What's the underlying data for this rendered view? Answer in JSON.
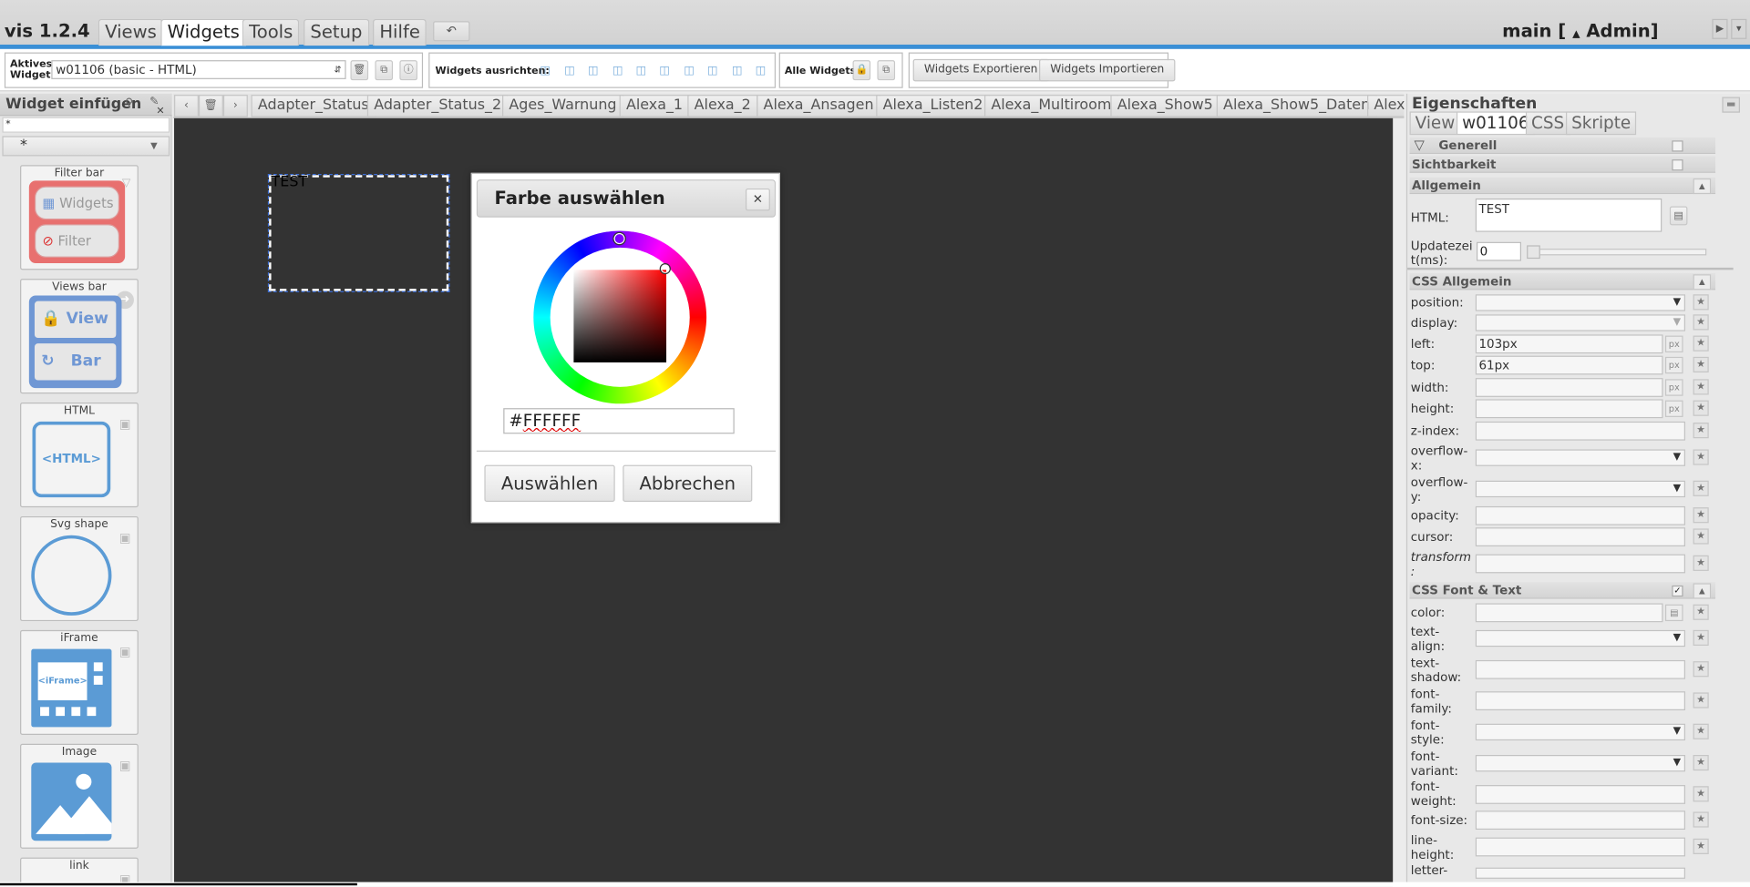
{
  "app": {
    "title": "vis 1.2.4",
    "project": "main [",
    "user": "Admin]",
    "undo_icon": "↶"
  },
  "menu": {
    "tabs": [
      "Views",
      "Widgets",
      "Tools",
      "Setup",
      "Hilfe"
    ],
    "active": "Widgets"
  },
  "toolbar": {
    "active_widget_label": "Aktives Widget:",
    "active_widget_value": "w01106 (basic - HTML)",
    "align_label": "Widgets ausrichten:",
    "all_widgets_label": "Alle Widgets:",
    "export_label": "Widgets Exportieren",
    "import_label": "Widgets Importieren"
  },
  "palette": {
    "title": "Widget einfügen",
    "filter_value": "*",
    "set_value": "*",
    "items": [
      {
        "label": "Filter bar",
        "btn1": "Widgets",
        "btn2": "Filter"
      },
      {
        "label": "Views bar",
        "btn1": "View",
        "btn2": "Bar"
      },
      {
        "label": "HTML",
        "icon_text": "<HTML>"
      },
      {
        "label": "Svg shape"
      },
      {
        "label": "iFrame",
        "icon_text": "<iFrame>"
      },
      {
        "label": "Image"
      },
      {
        "label": "link"
      }
    ]
  },
  "view_tabs": [
    "Adapter_Status",
    "Adapter_Status_2",
    "Ages_Warnung",
    "Alexa_1",
    "Alexa_2",
    "Alexa_Ansagen",
    "Alexa_Listen2",
    "Alexa_Multiroom",
    "Alexa_Show5",
    "Alexa_Show5_Daten",
    "Alex"
  ],
  "canvas": {
    "selected_widget_text": "TEST"
  },
  "dialog": {
    "title": "Farbe auswählen",
    "hex_prefix": "#",
    "hex_value": "FFFFFF",
    "ok_label": "Auswählen",
    "cancel_label": "Abbrechen"
  },
  "properties": {
    "title": "Eigenschaften",
    "tabs": [
      "View",
      "w01106",
      "CSS",
      "Skripte"
    ],
    "active_tab": "w01106",
    "sections": {
      "generell": "Generell",
      "sichtbarkeit": "Sichtbarkeit",
      "allgemein": "Allgemein",
      "css_allgemein": "CSS Allgemein",
      "css_font": "CSS Font & Text"
    },
    "html_label": "HTML:",
    "html_value": "TEST",
    "update_label_1": "Updatezei",
    "update_label_2": "t(ms):",
    "update_value": "0",
    "css": {
      "position": "position:",
      "display": "display:",
      "left": "left:",
      "left_value": "103px",
      "top": "top:",
      "top_value": "61px",
      "width": "width:",
      "height": "height:",
      "zindex": "z-index:",
      "overflowx_1": "overflow-",
      "overflowx_2": "x:",
      "overflowy_1": "overflow-",
      "overflowy_2": "y:",
      "opacity": "opacity:",
      "cursor": "cursor:",
      "transform_1": "transform",
      "transform_2": ":"
    },
    "font": {
      "color": "color:",
      "textalign_1": "text-",
      "textalign_2": "align:",
      "textshadow_1": "text-",
      "textshadow_2": "shadow:",
      "fontfamily_1": "font-",
      "fontfamily_2": "family:",
      "fontstyle_1": "font-",
      "fontstyle_2": "style:",
      "fontvariant_1": "font-",
      "fontvariant_2": "variant:",
      "fontweight_1": "font-",
      "fontweight_2": "weight:",
      "fontsize": "font-size:",
      "lineheight_1": "line-",
      "lineheight_2": "height:",
      "letter": "letter-"
    },
    "px": "px"
  },
  "colors": {
    "accent": "#3a8fd6",
    "canvas": "#333333",
    "palette_red": "#e8706f",
    "palette_blue": "#6f97d4"
  }
}
